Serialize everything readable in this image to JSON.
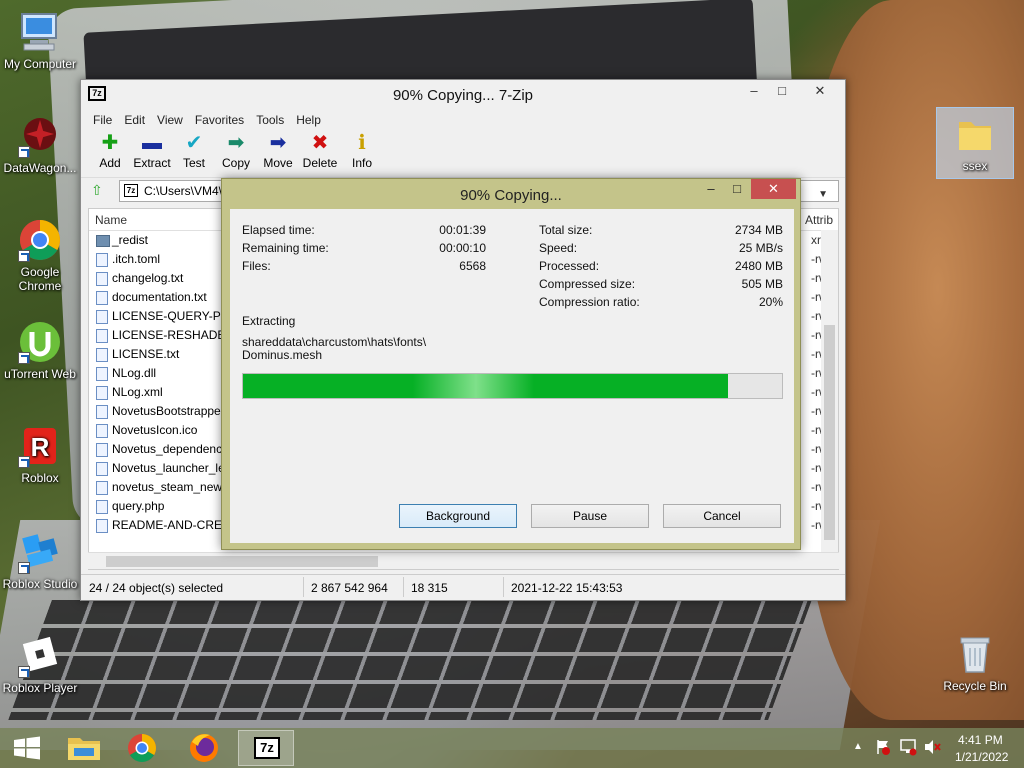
{
  "desktop": {
    "icons": [
      {
        "label": "My Computer"
      },
      {
        "label": "DataWagon..."
      },
      {
        "label": "Google Chrome"
      },
      {
        "label": "uTorrent Web"
      },
      {
        "label": "Roblox"
      },
      {
        "label": "Roblox Studio"
      },
      {
        "label": "Roblox Player"
      },
      {
        "label": "ssex"
      },
      {
        "label": "Recycle Bin"
      }
    ]
  },
  "main_window": {
    "title": "90% Copying... 7-Zip",
    "app_icon_text": "7z",
    "window_buttons": {
      "minimize": "–",
      "maximize": "□",
      "close": "✕"
    },
    "menu": [
      "File",
      "Edit",
      "View",
      "Favorites",
      "Tools",
      "Help"
    ],
    "toolbar": [
      {
        "label": "Add",
        "icon": "plus-icon",
        "glyph": "✚",
        "color": "#16a016"
      },
      {
        "label": "Extract",
        "icon": "minus-icon",
        "glyph": "▬",
        "color": "#1a2f9e"
      },
      {
        "label": "Test",
        "icon": "check-icon",
        "glyph": "✔",
        "color": "#17a7c4"
      },
      {
        "label": "Copy",
        "icon": "copy-arrow-icon",
        "glyph": "➡",
        "color": "#1a8a6a"
      },
      {
        "label": "Move",
        "icon": "move-arrow-icon",
        "glyph": "➡",
        "color": "#1a2f9e"
      },
      {
        "label": "Delete",
        "icon": "delete-x-icon",
        "glyph": "✖",
        "color": "#d01010"
      },
      {
        "label": "Info",
        "icon": "info-icon",
        "glyph": "ℹ",
        "color": "#c9a000"
      }
    ],
    "address": "C:\\Users\\VM4\\",
    "columns": {
      "name": "Name",
      "attributes": "Attrib"
    },
    "files": [
      {
        "name": "_redist",
        "type": "folder",
        "attr": "xrw"
      },
      {
        "name": ".itch.toml",
        "type": "file",
        "attr": "-rw"
      },
      {
        "name": "changelog.txt",
        "type": "file",
        "attr": "-rw"
      },
      {
        "name": "documentation.txt",
        "type": "file",
        "attr": "-rw"
      },
      {
        "name": "LICENSE-QUERY-PHP",
        "type": "file",
        "attr": "-rw"
      },
      {
        "name": "LICENSE-RESHADE.tx",
        "type": "file",
        "attr": "-rw"
      },
      {
        "name": "LICENSE.txt",
        "type": "file",
        "attr": "-rw"
      },
      {
        "name": "NLog.dll",
        "type": "file",
        "attr": "-rw"
      },
      {
        "name": "NLog.xml",
        "type": "file",
        "attr": "-rw"
      },
      {
        "name": "NovetusBootstrapper",
        "type": "file",
        "attr": "-rw"
      },
      {
        "name": "NovetusIcon.ico",
        "type": "file",
        "attr": "-rw"
      },
      {
        "name": "Novetus_dependency",
        "type": "file",
        "attr": "-rw"
      },
      {
        "name": "Novetus_launcher_leg",
        "type": "file",
        "attr": "-rw"
      },
      {
        "name": "novetus_steam_new.p",
        "type": "file",
        "attr": "-rw"
      },
      {
        "name": "query.php",
        "type": "file",
        "attr": "-rw"
      },
      {
        "name": "README-AND-CREDI",
        "type": "file",
        "attr": "-rw"
      }
    ],
    "status": {
      "selection": "24 / 24 object(s) selected",
      "size": "2 867 542 964",
      "packed": "18 315",
      "modified": "2021-12-22 15:43:53"
    }
  },
  "progress_dialog": {
    "title": "90% Copying...",
    "window_buttons": {
      "minimize": "–",
      "maximize": "□",
      "close": "✕"
    },
    "elapsed_label": "Elapsed time:",
    "elapsed": "00:01:39",
    "remaining_label": "Remaining time:",
    "remaining": "00:00:10",
    "files_label": "Files:",
    "files": "6568",
    "total_size_label": "Total size:",
    "total_size": "2734 MB",
    "speed_label": "Speed:",
    "speed": "25 MB/s",
    "processed_label": "Processed:",
    "processed": "2480 MB",
    "compressed_label": "Compressed size:",
    "compressed": "505 MB",
    "ratio_label": "Compression ratio:",
    "ratio": "20%",
    "operation": "Extracting",
    "current_path": "shareddata\\charcustom\\hats\\fonts\\",
    "current_file": "Dominus.mesh",
    "progress_fraction": 0.9,
    "progress_color": "#06b025",
    "buttons": {
      "background": "Background",
      "pause": "Pause",
      "cancel": "Cancel"
    }
  },
  "taskbar": {
    "time": "4:41 PM",
    "date": "1/21/2022",
    "items": [
      {
        "name": "start-button",
        "icon": "windows-logo-icon"
      },
      {
        "name": "taskbar-file-explorer",
        "icon": "file-explorer-icon"
      },
      {
        "name": "taskbar-chrome",
        "icon": "chrome-icon"
      },
      {
        "name": "taskbar-firefox",
        "icon": "firefox-icon"
      },
      {
        "name": "taskbar-7zip",
        "icon": "7zip-icon",
        "text": "7z"
      }
    ]
  }
}
